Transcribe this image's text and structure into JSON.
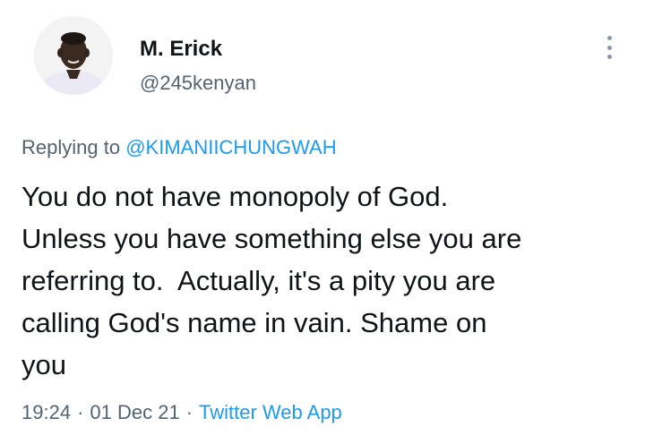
{
  "author": {
    "name": "M. Erick",
    "handle": "@245kenyan"
  },
  "more_icon": "more-vertical-icon",
  "reply": {
    "prefix": "Replying to",
    "mention": "@KIMANIICHUNGWAH"
  },
  "tweet": {
    "text": "You do not have monopoly of God.\nUnless you have something else you are\nreferring to.  Actually, it's a pity you are\ncalling God's name in vain. Shame on\nyou"
  },
  "meta": {
    "time": "19:24",
    "date": "01 Dec 21",
    "separator": "·",
    "source": "Twitter Web App"
  },
  "colors": {
    "accent": "#1d9bf0",
    "secondary_text": "#536471",
    "primary_text": "#0f1419"
  }
}
